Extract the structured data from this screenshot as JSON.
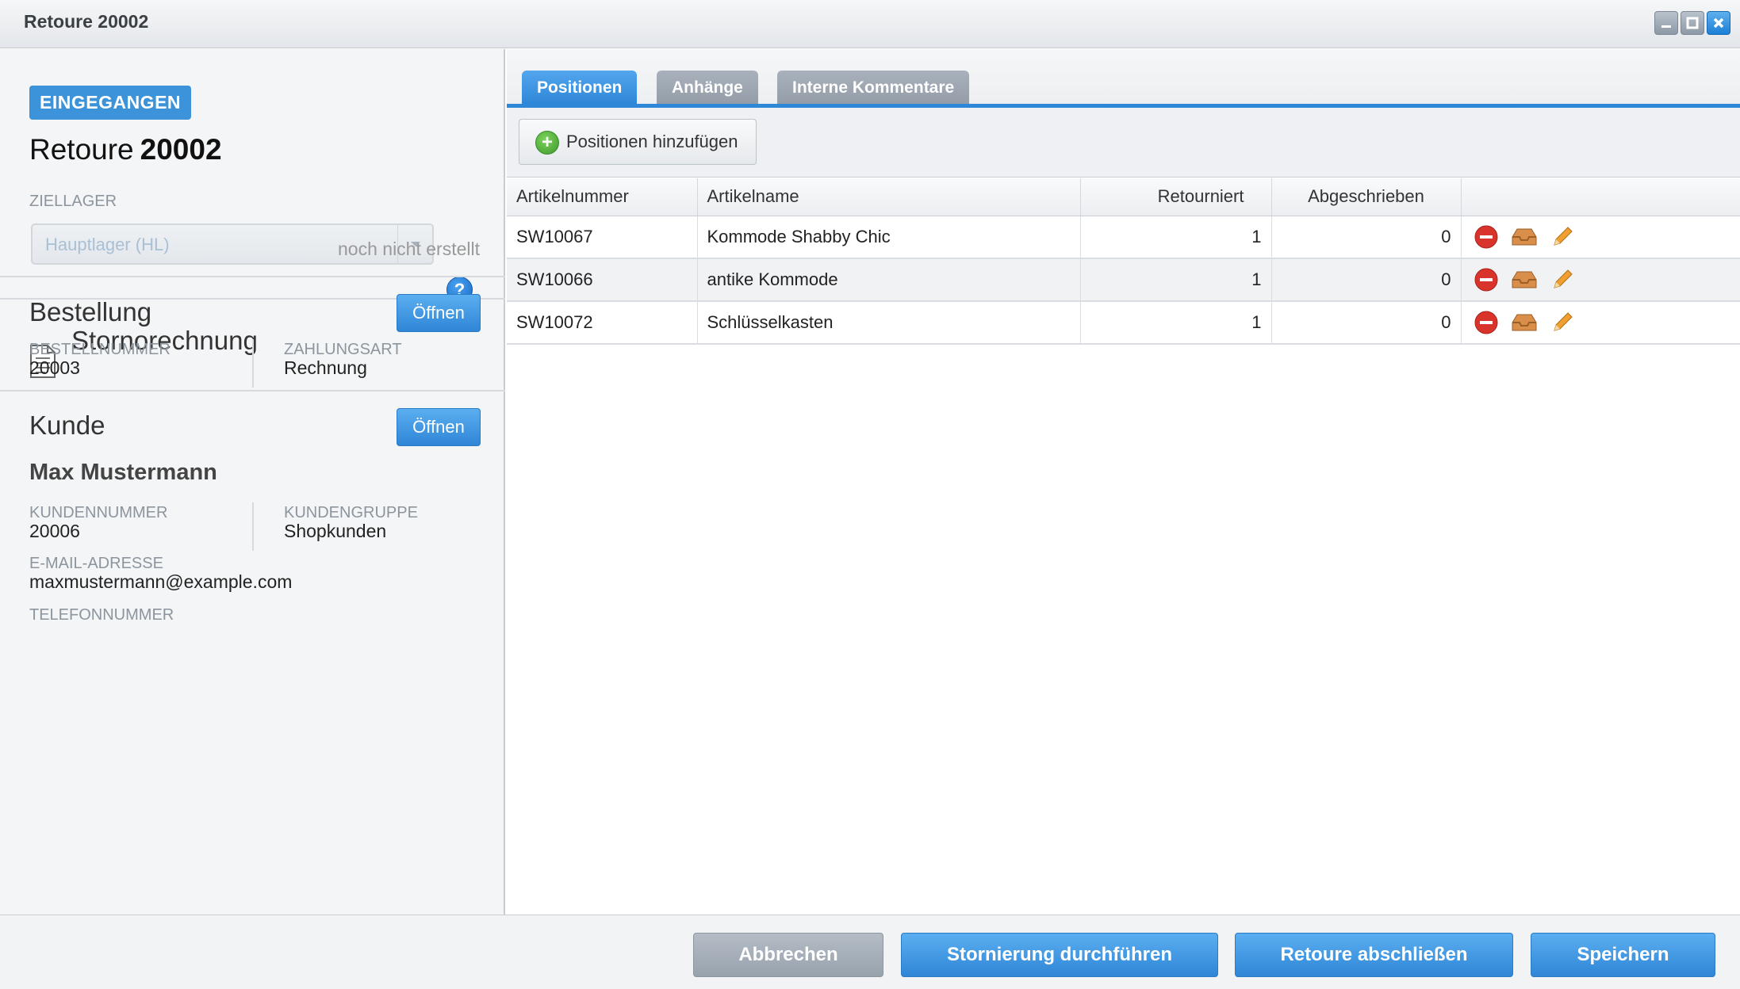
{
  "window": {
    "title": "Retoure 20002"
  },
  "left": {
    "status_badge": "EINGEGANGEN",
    "retoure_label": "Retoure",
    "retoure_number": "20002",
    "ziellager_label": "ZIELLAGER",
    "ziellager_placeholder": "Hauptlager (HL)",
    "storno": {
      "title": "Stornorechnung",
      "status": "noch nicht erstellt"
    },
    "bestellung": {
      "title": "Bestellung",
      "open_label": "Öffnen",
      "bestellnummer_label": "BESTELLNUMMER",
      "bestellnummer": "20003",
      "zahlungsart_label": "ZAHLUNGSART",
      "zahlungsart": "Rechnung"
    },
    "kunde": {
      "title": "Kunde",
      "open_label": "Öffnen",
      "name": "Max Mustermann",
      "kundennummer_label": "KUNDENNUMMER",
      "kundennummer": "20006",
      "kundengruppe_label": "KUNDENGRUPPE",
      "kundengruppe": "Shopkunden",
      "email_label": "E-MAIL-ADRESSE",
      "email": "maxmustermann@example.com",
      "telefon_label": "TELEFONNUMMER"
    }
  },
  "tabs": [
    {
      "label": "Positionen",
      "active": true
    },
    {
      "label": "Anhänge",
      "active": false
    },
    {
      "label": "Interne Kommentare",
      "active": false
    }
  ],
  "toolbar": {
    "add_label": "Positionen hinzufügen"
  },
  "grid": {
    "columns": [
      "Artikelnummer",
      "Artikelname",
      "Retourniert",
      "Abgeschrieben"
    ],
    "rows": [
      {
        "artikelnummer": "SW10067",
        "artikelname": "Kommode Shabby Chic",
        "retourniert": "1",
        "abgeschrieben": "0"
      },
      {
        "artikelnummer": "SW10066",
        "artikelname": "antike Kommode",
        "retourniert": "1",
        "abgeschrieben": "0"
      },
      {
        "artikelnummer": "SW10072",
        "artikelname": "Schlüsselkasten",
        "retourniert": "1",
        "abgeschrieben": "0"
      }
    ]
  },
  "footer": {
    "cancel_label": "Abbrechen",
    "storno_label": "Stornierung durchführen",
    "close_label": "Retoure abschließen",
    "save_label": "Speichern"
  },
  "colors": {
    "accent": "#2f87d7",
    "badge": "#3c93d9",
    "delete": "#d9342b",
    "edit": "#f0a030"
  }
}
